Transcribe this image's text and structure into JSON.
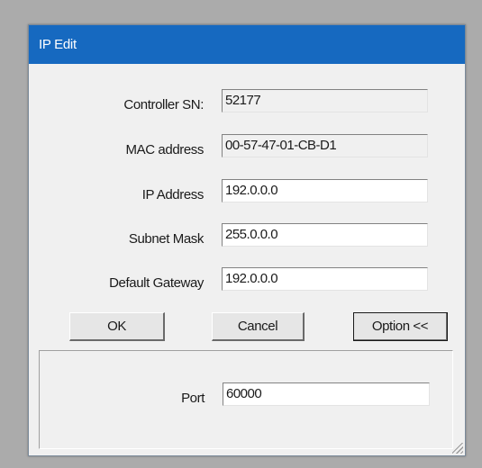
{
  "window": {
    "title": "IP Edit"
  },
  "fields": {
    "controller_sn": {
      "label": "Controller SN:",
      "value": "52177"
    },
    "mac_address": {
      "label": "MAC address",
      "value": "00-57-47-01-CB-D1"
    },
    "ip_address": {
      "label": "IP Address",
      "value": "192.0.0.0"
    },
    "subnet_mask": {
      "label": "Subnet Mask",
      "value": "255.0.0.0"
    },
    "default_gateway": {
      "label": "Default Gateway",
      "value": "192.0.0.0"
    },
    "port": {
      "label": "Port",
      "value": "60000"
    }
  },
  "buttons": {
    "ok": "OK",
    "cancel": "Cancel",
    "option": "Option <<"
  },
  "colors": {
    "titlebar": "#1669c0",
    "dialog_bg": "#f0f0f0",
    "field_bg": "#ffffff"
  }
}
